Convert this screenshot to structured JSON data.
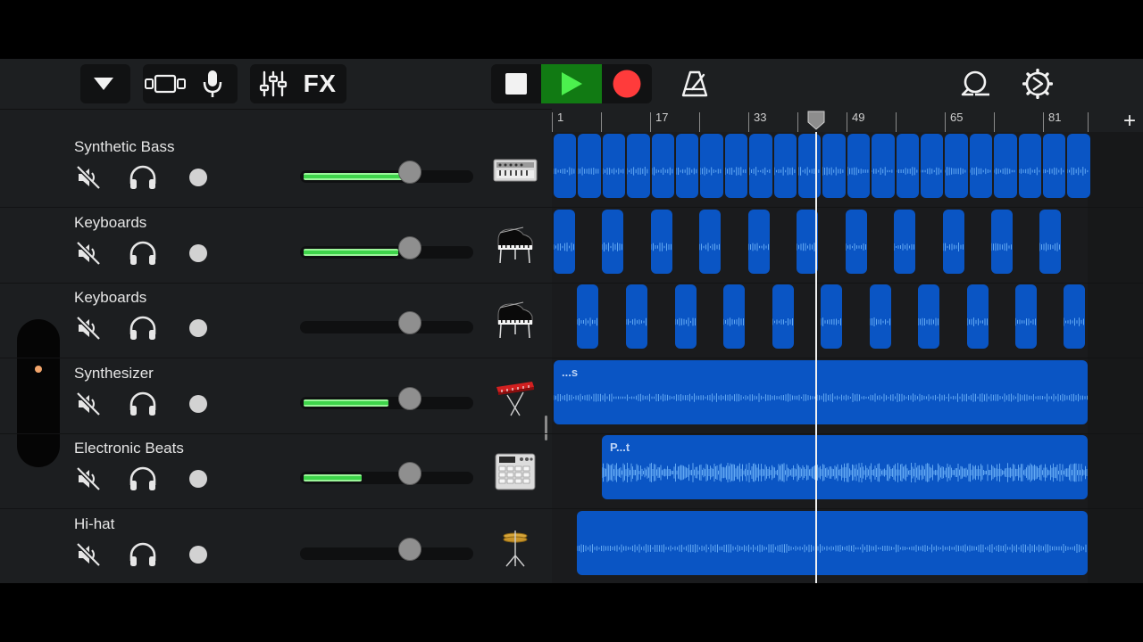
{
  "toolbar": {
    "fx_label": "FX",
    "icons": [
      "browser-dropdown-icon",
      "tracks-view-icon",
      "microphone-icon",
      "mixer-icon",
      "stop-icon",
      "play-icon",
      "record-icon",
      "metronome-icon",
      "loop-icon",
      "settings-icon"
    ],
    "colors": {
      "play": "#117a13",
      "record": "#ff3b3b",
      "stop": "#f2f2f2"
    }
  },
  "ruler": {
    "labels": [
      "1",
      "17",
      "33",
      "49",
      "65",
      "81"
    ],
    "add_label": "+"
  },
  "tracks": [
    {
      "name": "Synthetic Bass",
      "volume": 0.66,
      "meter": 0.66,
      "instrument": "synth-module-icon"
    },
    {
      "name": "Keyboards",
      "volume": 0.66,
      "meter": 0.57,
      "instrument": "grand-piano-icon"
    },
    {
      "name": "Keyboards",
      "volume": 0.66,
      "meter": 0.0,
      "instrument": "grand-piano-icon"
    },
    {
      "name": "Synthesizer",
      "volume": 0.66,
      "meter": 0.51,
      "instrument": "keytar-synth-icon"
    },
    {
      "name": "Electronic Beats",
      "volume": 0.66,
      "meter": 0.35,
      "instrument": "drum-machine-icon"
    },
    {
      "name": "Hi-hat",
      "volume": 0.66,
      "meter": 0.0,
      "instrument": "hihat-cymbal-icon"
    }
  ],
  "regions": {
    "synthesizer_label": "...s",
    "electronic_beats_label": "P...t"
  },
  "colors": {
    "region": "#0a55c4",
    "waveform": "#62a8f2",
    "meter": "#3ed44a",
    "background": "#1c1e20"
  }
}
